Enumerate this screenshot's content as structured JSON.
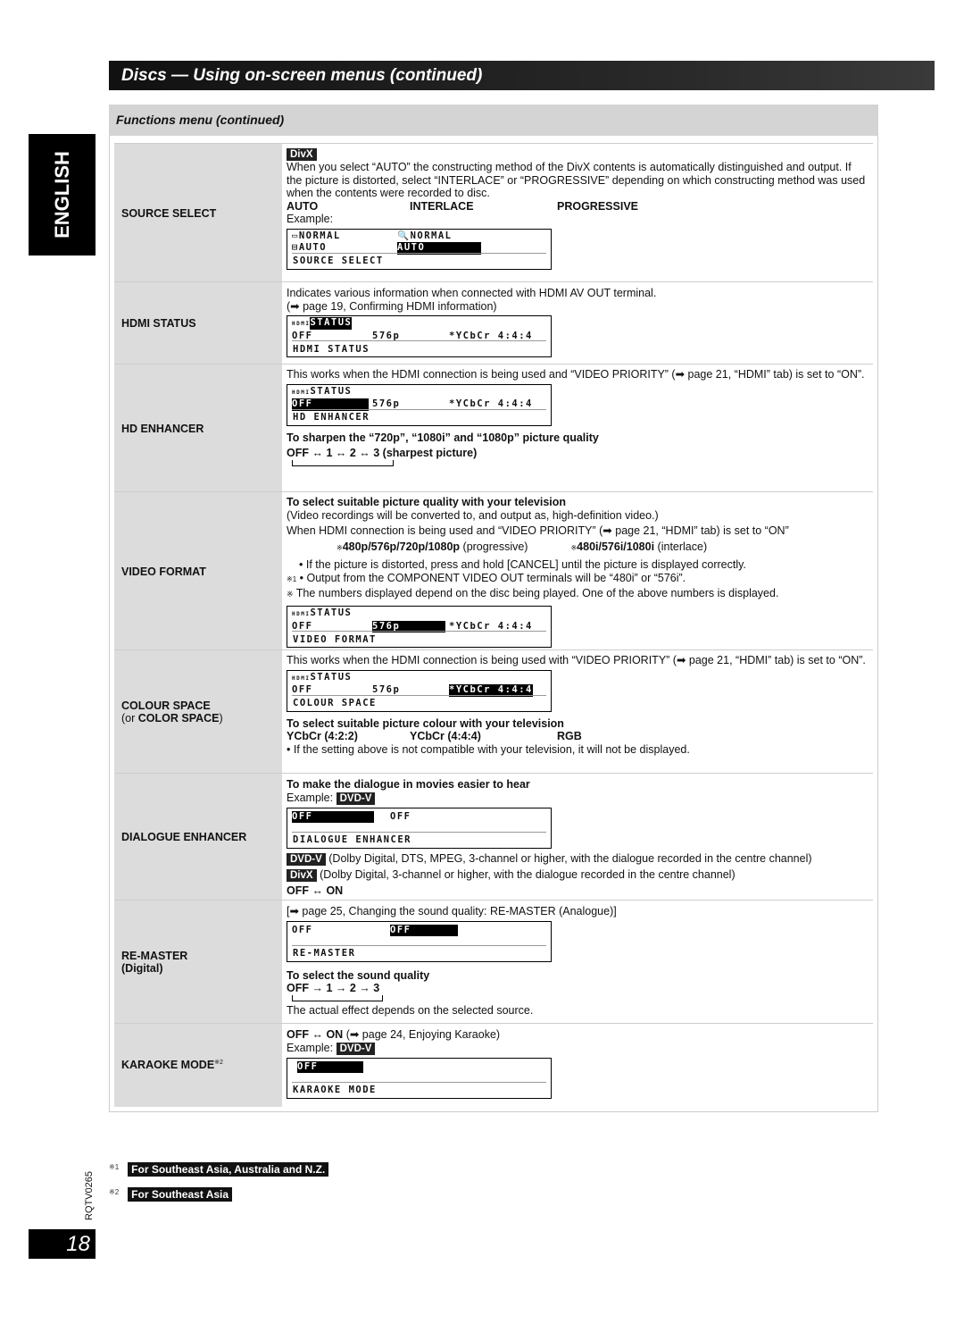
{
  "header": {
    "title": "Discs — Using on-screen menus (continued)",
    "subtitle": "Functions menu (continued)",
    "language_tab": "ENGLISH"
  },
  "rows": [
    {
      "label": "SOURCE SELECT",
      "tag": "DivX",
      "text": "When you select “AUTO” the constructing method of the DivX contents is automatically distinguished and output. If the picture is distorted, select “INTERLACE” or “PROGRESSIVE” depending on which constructing method was used when the contents were recorded to disc.",
      "options": [
        "AUTO",
        "INTERLACE",
        "PROGRESSIVE"
      ],
      "example": "Example:",
      "osd": {
        "l1a": "▭NORMAL",
        "l1b": "🔍NORMAL",
        "l2a": "⊟AUTO",
        "l2b": "AUTO",
        "bottom": "SOURCE SELECT"
      }
    },
    {
      "label": "HDMI STATUS",
      "text": "Indicates various information when connected with HDMI AV OUT terminal.",
      "ref": "(➡ page 19, Confirming HDMI information)",
      "osd": {
        "l1": "STATUS",
        "a": "OFF",
        "b": "576p",
        "c": "*YCbCr 4:4:4",
        "bottom": "HDMI STATUS"
      }
    },
    {
      "label": "HD ENHANCER",
      "text": "This works when the HDMI connection is being used and “VIDEO PRIORITY” (➡ page 21, “HDMI” tab) is set to “ON”.",
      "osd": {
        "l1": "STATUS",
        "a": "OFF",
        "b": "576p",
        "c": "*YCbCr 4:4:4",
        "bottom": "HD ENHANCER"
      },
      "heading": "To sharpen the “720p”, “1080i” and “1080p” picture quality",
      "cycle": "OFF ↔ 1 ↔ 2 ↔ 3 (sharpest picture)"
    },
    {
      "label": "VIDEO FORMAT",
      "heading": "To select suitable picture quality with your television",
      "l1": "(Video recordings will be converted to, and output as, high-definition video.)",
      "l2": "When HDMI connection is being used and “VIDEO PRIORITY” (➡ page 21, “HDMI” tab) is set to “ON”",
      "prog": "480p/576p/720p/1080p",
      "prog_note": "(progressive)",
      "inter": "480i/576i/1080i",
      "inter_note": "(interlace)",
      "b1": "• If the picture is distorted, press and hold [CANCEL] until the picture is displayed correctly.",
      "b2": "• Output from the COMPONENT VIDEO OUT terminals will be “480i” or “576i”.",
      "b3": "The numbers displayed depend on the disc being played. One of the above numbers is displayed.",
      "osd": {
        "l1": "STATUS",
        "a": "OFF",
        "b": "576p",
        "c": "*YCbCr 4:4:4",
        "bottom": "VIDEO FORMAT"
      }
    },
    {
      "label": "COLOUR SPACE",
      "label2_pre": "(or ",
      "label2": "COLOR SPACE",
      "label2_post": ")",
      "text": "This works when the HDMI connection is being used with “VIDEO PRIORITY” (➡ page 21, “HDMI” tab) is set to “ON”.",
      "osd": {
        "l1": "STATUS",
        "a": "OFF",
        "b": "576p",
        "c": "*YCbCr 4:4:4",
        "bottom": "COLOUR SPACE"
      },
      "heading": "To select suitable picture colour with your television",
      "options": [
        "YCbCr (4:2:2)",
        "YCbCr (4:4:4)",
        "RGB"
      ],
      "note": "• If the setting above is not compatible with your television, it will not be displayed."
    },
    {
      "label": "DIALOGUE ENHANCER",
      "heading": "To make the dialogue in movies easier to hear",
      "example": "Example:",
      "tag": "DVD-V",
      "osd": {
        "a": "OFF",
        "b": "OFF",
        "bottom": "DIALOGUE ENHANCER"
      },
      "t1tag": "DVD-V",
      "t1": "(Dolby Digital, DTS, MPEG, 3-channel or higher, with the dialogue recorded in the centre channel)",
      "t2tag": "DivX",
      "t2": "(Dolby Digital, 3-channel or higher, with the dialogue recorded in the centre channel)",
      "cycle": "OFF ↔ ON"
    },
    {
      "label": "RE-MASTER",
      "label2": "(Digital)",
      "ref": "[➡ page 25, Changing the sound quality: RE-MASTER (Analogue)]",
      "osd": {
        "a": "OFF",
        "b": "OFF",
        "bottom": "RE-MASTER"
      },
      "heading": "To select the sound quality",
      "cycle": "OFF → 1 → 2 → 3",
      "note": "The actual effect depends on the selected source."
    },
    {
      "label": "KARAOKE MODE",
      "label_sup": "※2",
      "text_b": "OFF ↔ ON",
      "ref": "(➡ page 24, Enjoying Karaoke)",
      "example": "Example:",
      "tag": "DVD-V",
      "osd": {
        "a": "OFF",
        "bottom": "KARAOKE MODE"
      }
    }
  ],
  "footnotes": [
    {
      "mark": "※1",
      "text": "For Southeast Asia, Australia and N.Z."
    },
    {
      "mark": "※2",
      "text": "For Southeast Asia"
    }
  ],
  "doc_code": "RQTV0265",
  "page_number": "18"
}
